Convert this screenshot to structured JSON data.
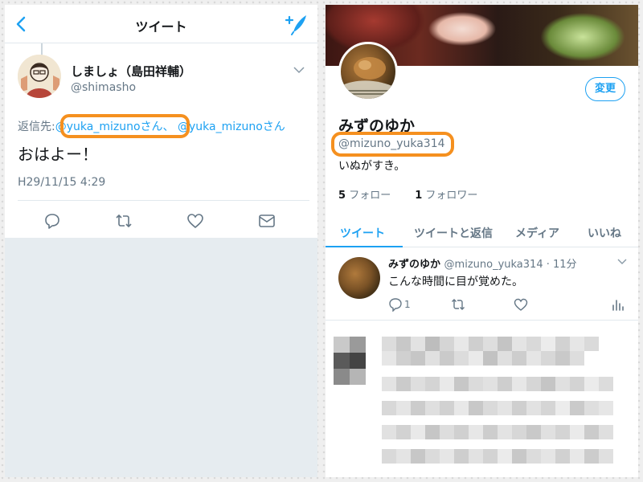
{
  "left": {
    "nav_title": "ツイート",
    "author_name": "しましょ（島田祥輔）",
    "author_handle": "@shimasho",
    "reply_prefix": "返信先:",
    "reply_mention_1": "@yuka_mizunoさん、",
    "reply_mention_2": "@yuka_mizunoさん",
    "tweet_text": "おはよー！",
    "timestamp": "H29/11/15 4:29"
  },
  "right": {
    "edit_button": "変更",
    "display_name": "みずのゆか",
    "handle": "@mizuno_yuka314",
    "bio": "いぬがすき。",
    "following_count": "5",
    "following_label": "フォロー",
    "followers_count": "1",
    "followers_label": "フォロワー",
    "tabs": [
      "ツイート",
      "ツイートと返信",
      "メディア",
      "いいね"
    ],
    "timeline": {
      "name": "みずのゆか",
      "handle_time": "@mizuno_yuka314 · 11分",
      "text": "こんな時間に目が覚めた。",
      "reply_count": "1"
    }
  },
  "colors": {
    "accent": "#1da1f2",
    "highlight": "#f5901f",
    "muted": "#657786"
  }
}
